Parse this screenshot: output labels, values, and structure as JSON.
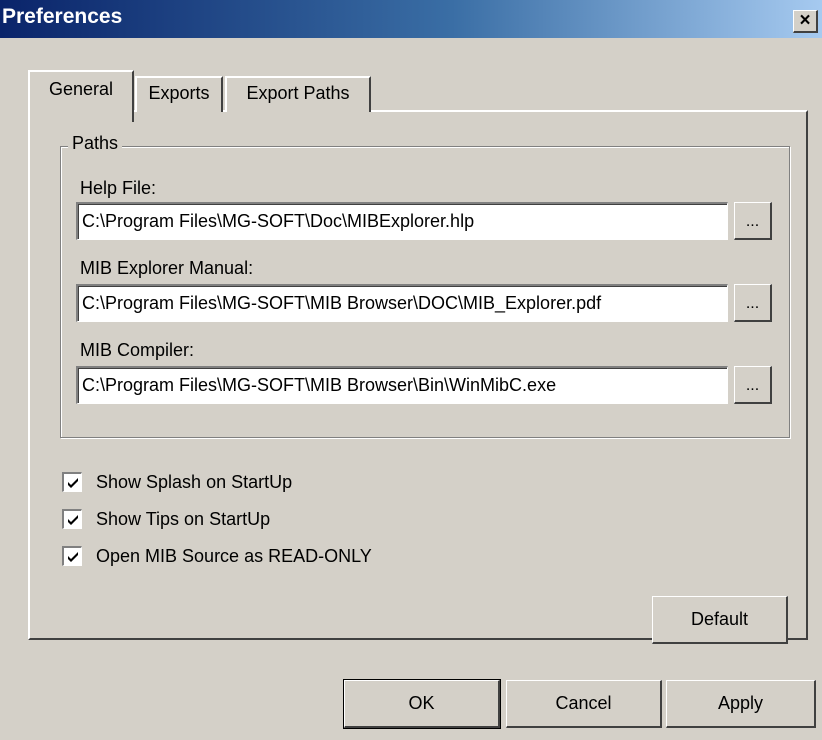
{
  "window": {
    "title": "Preferences",
    "close_glyph": "×"
  },
  "tabs": [
    {
      "label": "General",
      "selected": true
    },
    {
      "label": "Exports",
      "selected": false
    },
    {
      "label": "Export Paths",
      "selected": false
    }
  ],
  "paths_group": {
    "title": "Paths",
    "fields": [
      {
        "label": "Help File:",
        "value": "C:\\Program Files\\MG-SOFT\\Doc\\MIBExplorer.hlp",
        "browse_label": "..."
      },
      {
        "label": "MIB Explorer Manual:",
        "value": "C:\\Program Files\\MG-SOFT\\MIB Browser\\DOC\\MIB_Explorer.pdf",
        "browse_label": "..."
      },
      {
        "label": "MIB Compiler:",
        "value": "C:\\Program Files\\MG-SOFT\\MIB Browser\\Bin\\WinMibC.exe",
        "browse_label": "..."
      }
    ]
  },
  "options": [
    {
      "label": "Show Splash on StartUp",
      "checked": true
    },
    {
      "label": "Show Tips on StartUp",
      "checked": true
    },
    {
      "label": "Open MIB Source as READ-ONLY",
      "checked": true
    }
  ],
  "buttons": {
    "default": "Default",
    "ok": "OK",
    "cancel": "Cancel",
    "apply": "Apply"
  },
  "colors": {
    "face": "#d4d0c8",
    "title_start": "#0a246a",
    "title_end": "#a6caf0"
  }
}
